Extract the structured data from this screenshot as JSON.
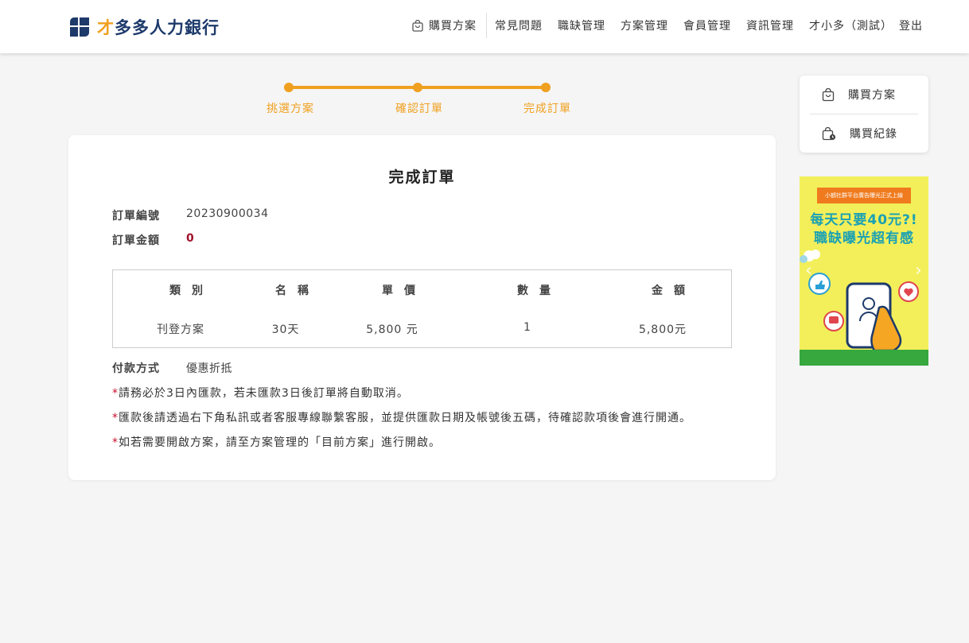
{
  "header": {
    "brand": {
      "first": "才",
      "rest": "多多人力銀行"
    },
    "nav": {
      "buy_plan": "購買方案",
      "faq": "常見問題",
      "job_mgmt": "職缺管理",
      "plan_mgmt": "方案管理",
      "member_mgmt": "會員管理",
      "info_mgmt": "資訊管理",
      "user": "才小多（測試）",
      "logout": "登出"
    }
  },
  "stepper": {
    "steps": [
      "挑選方案",
      "確認訂單",
      "完成訂單"
    ],
    "current_index": 2,
    "color": "#f0a020"
  },
  "order": {
    "title": "完成訂單",
    "number_label": "訂單編號",
    "number": "20230900034",
    "amount_label": "訂單金額",
    "amount": "0",
    "table": {
      "headers": [
        "類別",
        "名稱",
        "單價",
        "數量",
        "金額"
      ],
      "rows": [
        [
          "刊登方案",
          "30天",
          "5,800 元",
          "1",
          "5,800元"
        ]
      ]
    },
    "payment_label": "付款方式",
    "payment": "優惠折抵",
    "notes": [
      "請務必於3日內匯款，若未匯款3日後訂單將自動取消。",
      "匯款後請透過右下角私訊或者客服專線聯繫客服，並提供匯款日期及帳號後五碼，待確認款項後會進行開通。",
      "如若需要開啟方案，請至方案管理的「目前方案」進行開啟。"
    ],
    "note_marker": "*"
  },
  "side_menu": {
    "items": [
      {
        "label": "購買方案",
        "icon": "shopping-bag-icon"
      },
      {
        "label": "購買紀錄",
        "icon": "purchase-history-icon"
      }
    ]
  },
  "banner": {
    "ribbon": "小額社群平台廣告曝光正式上線",
    "line1": "每天只要40元?!",
    "line2": "職缺曝光超有感"
  }
}
